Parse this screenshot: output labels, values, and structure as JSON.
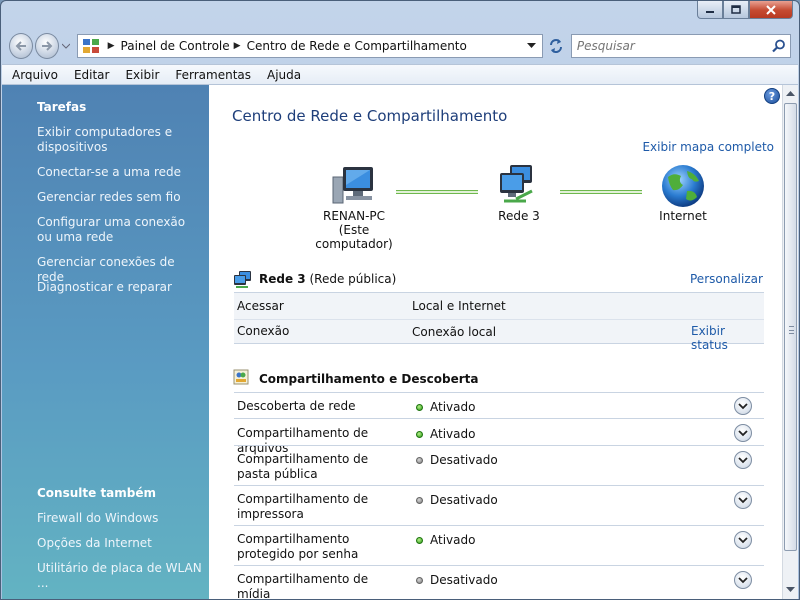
{
  "window": {
    "caption_buttons": [
      "minimize-icon",
      "maximize-icon",
      "close-icon"
    ]
  },
  "nav": {
    "breadcrumb": [
      "Painel de Controle",
      "Centro de Rede e Compartilhamento"
    ],
    "search_placeholder": "Pesquisar"
  },
  "menu": [
    "Arquivo",
    "Editar",
    "Exibir",
    "Ferramentas",
    "Ajuda"
  ],
  "sidebar": {
    "tasks_title": "Tarefas",
    "tasks": [
      "Exibir computadores e dispositivos",
      "Conectar-se a uma rede",
      "Gerenciar redes sem fio",
      "Configurar uma conexão ou uma rede",
      "Gerenciar conexões de rede",
      "Diagnosticar e reparar"
    ],
    "see_also_title": "Consulte também",
    "see_also": [
      "Firewall do Windows",
      "Opções da Internet",
      "Utilitário de placa de WLAN ..."
    ]
  },
  "main": {
    "help_label": "?",
    "title": "Centro de Rede e Compartilhamento",
    "full_map_link": "Exibir mapa completo",
    "map": {
      "computer_name": "RENAN-PC",
      "computer_sub": "(Este computador)",
      "network_name": "Rede  3",
      "internet_label": "Internet"
    },
    "network": {
      "name": "Rede  3",
      "type": "(Rede pública)",
      "customize_link": "Personalizar",
      "access_label": "Acessar",
      "access_value": "Local e Internet",
      "connection_label": "Conexão",
      "connection_value": "Conexão local",
      "status_link": "Exibir status"
    },
    "sharing": {
      "title": "Compartilhamento e Descoberta",
      "items": [
        {
          "label": "Descoberta de rede",
          "status": "Ativado",
          "on": true
        },
        {
          "label": "Compartilhamento de arquivos",
          "status": "Ativado",
          "on": true
        },
        {
          "label": "Compartilhamento de pasta pública",
          "status": "Desativado",
          "on": false
        },
        {
          "label": "Compartilhamento de impressora",
          "status": "Desativado",
          "on": false
        },
        {
          "label": "Compartilhamento protegido por senha",
          "status": "Ativado",
          "on": true
        },
        {
          "label": "Compartilhamento de mídia",
          "status": "Desativado",
          "on": false
        }
      ]
    }
  },
  "colors": {
    "sidebar_top": "#4f82b3",
    "sidebar_bottom": "#63b3c2",
    "link": "#1e5aa8",
    "title": "#1e3e7a",
    "status_on": "#2b9a16",
    "status_off": "#7a7a7a"
  }
}
